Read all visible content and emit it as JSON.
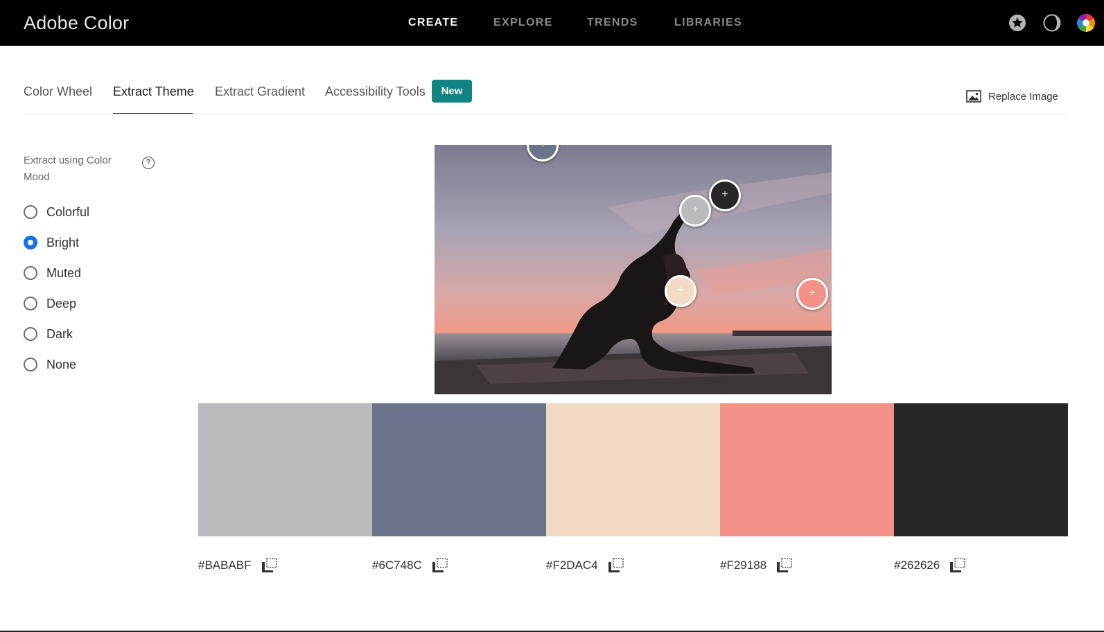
{
  "app": {
    "title": "Adobe Color"
  },
  "nav": {
    "items": [
      "CREATE",
      "EXPLORE",
      "TRENDS",
      "LIBRARIES"
    ],
    "active": "CREATE"
  },
  "tabs": {
    "items": [
      "Color Wheel",
      "Extract Theme",
      "Extract Gradient",
      "Accessibility Tools"
    ],
    "active": "Extract Theme",
    "new_badge": "New"
  },
  "replace_image_label": "Replace Image",
  "sidebar": {
    "mood_label": "Extract using Color Mood",
    "help_icon": "?",
    "options": [
      "Colorful",
      "Bright",
      "Muted",
      "Deep",
      "Dark",
      "None"
    ],
    "selected": "Bright"
  },
  "swatches": [
    {
      "hex": "#BABABF",
      "color": "#BABABF"
    },
    {
      "hex": "#6C748C",
      "color": "#6C748C"
    },
    {
      "hex": "#F2DAC4",
      "color": "#F2DAC4"
    },
    {
      "hex": "#F29188",
      "color": "#F29188"
    },
    {
      "hex": "#262626",
      "color": "#262626"
    }
  ],
  "icons": {
    "favorites": "star-icon",
    "theme": "dark-mode-icon",
    "profile": "color-wheel-avatar-icon",
    "replace": "image-icon",
    "copy": "copy-icon",
    "handle": "plus-icon"
  },
  "colors": {
    "accent_blue": "#1473e6",
    "badge_teal": "#118484",
    "nav_bg": "#000000"
  }
}
